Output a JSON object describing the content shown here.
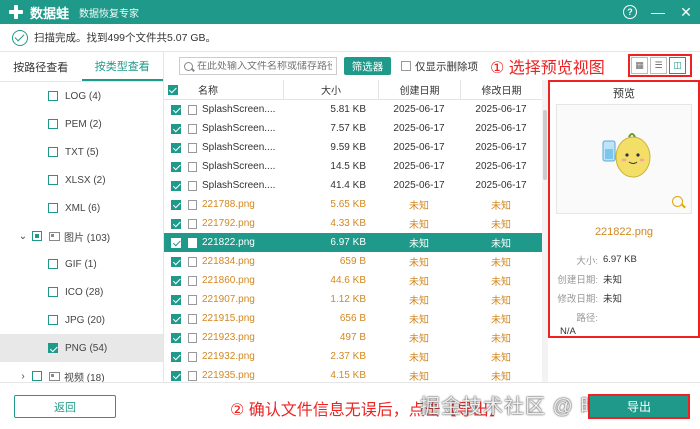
{
  "titlebar": {
    "app_name": "数据蛙",
    "app_subtitle": "数据恢复专家",
    "help": "?",
    "minimize": "—",
    "close": "✕"
  },
  "status": {
    "text": "扫描完成。找到499个文件共5.07 GB。"
  },
  "left_tabs": {
    "by_path": "按路径查看",
    "by_type": "按类型查看"
  },
  "tree": [
    {
      "label": "LOG (4)",
      "level": 1,
      "checked": false
    },
    {
      "label": "PEM (2)",
      "level": 1,
      "checked": false
    },
    {
      "label": "TXT (5)",
      "level": 1,
      "checked": false
    },
    {
      "label": "XLSX (2)",
      "level": 1,
      "checked": false
    },
    {
      "label": "XML (6)",
      "level": 1,
      "checked": false
    },
    {
      "label": "图片 (103)",
      "level": 0,
      "checked": true,
      "expanded": true
    },
    {
      "label": "GIF (1)",
      "level": 1,
      "checked": false
    },
    {
      "label": "ICO (28)",
      "level": 1,
      "checked": false
    },
    {
      "label": "JPG (20)",
      "level": 1,
      "checked": false
    },
    {
      "label": "PNG (54)",
      "level": 1,
      "checked": true,
      "selected": true
    },
    {
      "label": "视频 (18)",
      "level": 0,
      "checked": false,
      "expanded": false
    }
  ],
  "toolbar": {
    "search_placeholder": "在此处输入文件名称或储存路径",
    "filter_label": "筛选器",
    "only_deleted_label": "仅显示删除项",
    "annotation": "① 选择预览视图"
  },
  "table": {
    "headers": {
      "name": "名称",
      "size": "大小",
      "created": "创建日期",
      "modified": "修改日期"
    },
    "rows": [
      {
        "name": "SplashScreen....",
        "size": "5.81 KB",
        "created": "2025-06-17",
        "modified": "2025-06-17",
        "unknown": false,
        "selected": false
      },
      {
        "name": "SplashScreen....",
        "size": "7.57 KB",
        "created": "2025-06-17",
        "modified": "2025-06-17",
        "unknown": false,
        "selected": false
      },
      {
        "name": "SplashScreen....",
        "size": "9.59 KB",
        "created": "2025-06-17",
        "modified": "2025-06-17",
        "unknown": false,
        "selected": false
      },
      {
        "name": "SplashScreen....",
        "size": "14.5 KB",
        "created": "2025-06-17",
        "modified": "2025-06-17",
        "unknown": false,
        "selected": false
      },
      {
        "name": "SplashScreen....",
        "size": "41.4 KB",
        "created": "2025-06-17",
        "modified": "2025-06-17",
        "unknown": false,
        "selected": false
      },
      {
        "name": "221788.png",
        "size": "5.65 KB",
        "created": "未知",
        "modified": "未知",
        "unknown": true,
        "selected": false
      },
      {
        "name": "221792.png",
        "size": "4.33 KB",
        "created": "未知",
        "modified": "未知",
        "unknown": true,
        "selected": false
      },
      {
        "name": "221822.png",
        "size": "6.97 KB",
        "created": "未知",
        "modified": "未知",
        "unknown": true,
        "selected": true
      },
      {
        "name": "221834.png",
        "size": "659  B",
        "created": "未知",
        "modified": "未知",
        "unknown": true,
        "selected": false
      },
      {
        "name": "221860.png",
        "size": "44.6 KB",
        "created": "未知",
        "modified": "未知",
        "unknown": true,
        "selected": false
      },
      {
        "name": "221907.png",
        "size": "1.12 KB",
        "created": "未知",
        "modified": "未知",
        "unknown": true,
        "selected": false
      },
      {
        "name": "221915.png",
        "size": "656  B",
        "created": "未知",
        "modified": "未知",
        "unknown": true,
        "selected": false
      },
      {
        "name": "221923.png",
        "size": "497  B",
        "created": "未知",
        "modified": "未知",
        "unknown": true,
        "selected": false
      },
      {
        "name": "221932.png",
        "size": "2.37 KB",
        "created": "未知",
        "modified": "未知",
        "unknown": true,
        "selected": false
      },
      {
        "name": "221935.png",
        "size": "4.15 KB",
        "created": "未知",
        "modified": "未知",
        "unknown": true,
        "selected": false
      }
    ]
  },
  "preview": {
    "title": "预览",
    "filename": "221822.png",
    "size_label": "大小:",
    "size_value": "6.97 KB",
    "created_label": "创建日期:",
    "created_value": "未知",
    "modified_label": "修改日期:",
    "modified_value": "未知",
    "path_label": "路径:",
    "path_value": "N/A"
  },
  "bottom": {
    "back_label": "返回",
    "export_label": "导出",
    "annotation": "② 确认文件信息无误后，点击【导出】",
    "watermark": "掘金技术社区 @ 晴朗姐姐"
  },
  "colors": {
    "accent": "#1f9a8a",
    "unknown_text": "#d2881f",
    "annotation_red": "#ee2222"
  }
}
